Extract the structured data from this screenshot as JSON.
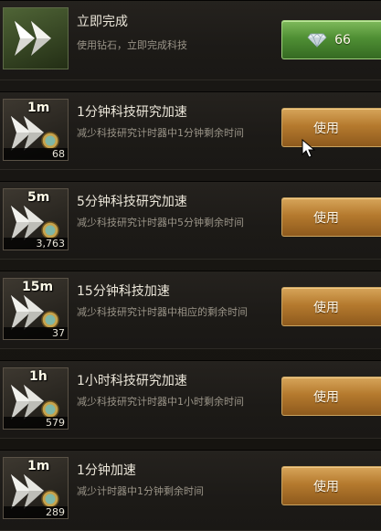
{
  "instant": {
    "title": "立即完成",
    "desc": "使用钻石，立即完成科技",
    "cost": "66",
    "icon": "double-arrow-icon",
    "gem_icon": "diamond-icon"
  },
  "items": [
    {
      "tag": "1m",
      "title": "1分钟科技研究加速",
      "desc": "减少科技研究计时器中1分钟剩余时间",
      "count": "68",
      "button": "使用"
    },
    {
      "tag": "5m",
      "title": "5分钟科技研究加速",
      "desc": "减少科技研究计时器中5分钟剩余时间",
      "count": "3,763",
      "button": "使用"
    },
    {
      "tag": "15m",
      "title": "15分钟科技加速",
      "desc": "减少科技研究计时器中相应的剩余时间",
      "count": "37",
      "button": "使用"
    },
    {
      "tag": "1h",
      "title": "1小时科技研究加速",
      "desc": "减少科技研究计时器中1小时剩余时间",
      "count": "579",
      "button": "使用"
    },
    {
      "tag": "1m",
      "title": "1分钟加速",
      "desc": "减少计时器中1分钟剩余时间",
      "count": "289",
      "button": "使用"
    }
  ],
  "colors": {
    "use_button": "#b57a2e",
    "instant_button": "#4f8f34",
    "title_text": "#ece7da",
    "desc_text": "#9a9488"
  }
}
